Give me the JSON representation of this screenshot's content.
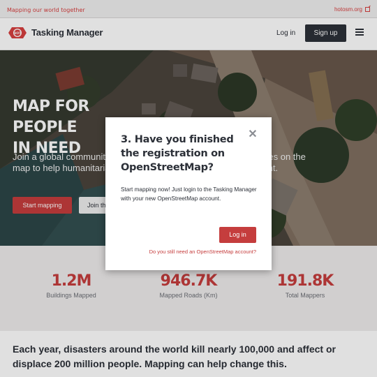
{
  "topbar": {
    "tagline": "Mapping our world together",
    "external_link": "hotosm.org",
    "external_icon": "external-link-icon"
  },
  "header": {
    "logo_text": "HOT",
    "brand": "Tasking Manager",
    "login": "Log in",
    "signup": "Sign up",
    "menu_icon": "hamburger-menu-icon"
  },
  "hero": {
    "title_line1": "MAP FOR PEOPLE",
    "title_line2": "IN NEED",
    "subtitle": "Join a global community of volunteers mapping people and places on the map to help humanitarian response and sustainable development.",
    "start_button": "Start mapping",
    "join_button": "Join the"
  },
  "stats": [
    {
      "value": "1.2M",
      "label": "Buildings Mapped"
    },
    {
      "value": "946.7K",
      "label": "Mapped Roads (Km)"
    },
    {
      "value": "191.8K",
      "label": "Total Mappers"
    }
  ],
  "mission": "Each year, disasters around the world kill nearly 100,000 and affect or displace 200 million people. Mapping can help change this.",
  "modal": {
    "title": "3. Have you finished the registration on OpenStreetMap?",
    "close_icon": "close-icon",
    "body": "Start mapping now! Just login to the Tasking Manager with your new OpenStreetMap account.",
    "login_button": "Log in",
    "account_link": "Do you still need an OpenStreetMap account?"
  },
  "colors": {
    "accent": "#c53d3d",
    "dark": "#2c3038",
    "stats_bg": "#eeecec"
  }
}
